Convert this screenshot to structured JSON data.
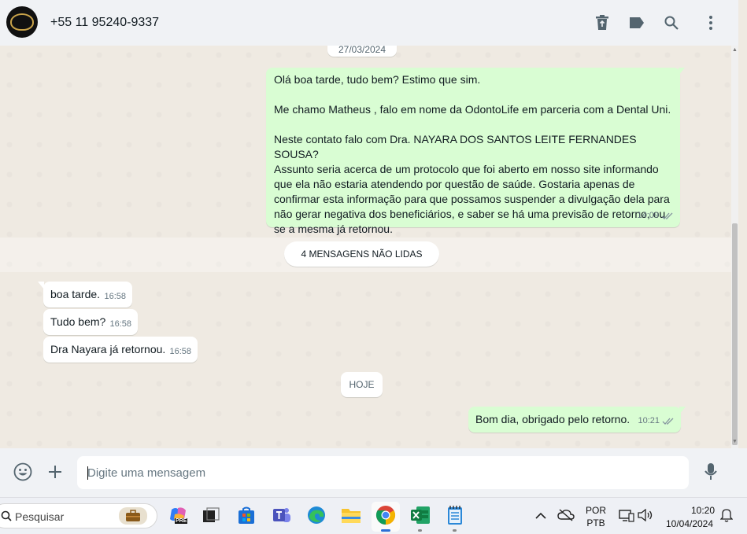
{
  "header": {
    "contact_name": "+55 11 95240-9337",
    "icons": [
      "delete-icon",
      "label-icon",
      "search-icon",
      "menu-icon"
    ]
  },
  "chat": {
    "date_top": "27/03/2024",
    "outgoing_long": {
      "lines": [
        "Olá boa tarde, tudo bem? Estimo que sim.",
        "",
        "Me chamo Matheus , falo em nome da OdontoLife em parceria com a Dental Uni.",
        "",
        "Neste contato falo com Dra. NAYARA DOS SANTOS LEITE FERNANDES SOUSA?",
        "Assunto seria acerca de um protocolo que foi aberto em nosso site informando",
        "que ela não estaria atendendo por questão de saúde. Gostaria apenas de",
        "confirmar esta informação para que possamos suspender a divulgação dela para",
        "não gerar negativa dos beneficiários, e saber se há uma previsão de retorno, ou",
        "se a mesma já retornou."
      ],
      "time": "14:09"
    },
    "unread_label": "4 MENSAGENS NÃO LIDAS",
    "incoming": [
      {
        "text": "boa tarde.",
        "time": "16:58"
      },
      {
        "text": "Tudo bem?",
        "time": "16:58"
      },
      {
        "text": "Dra Nayara já retornou.",
        "time": "16:58"
      }
    ],
    "date_today": "HOJE",
    "outgoing_last": {
      "text": "Bom dia, obrigado pelo retorno.",
      "time": "10:21"
    }
  },
  "composer": {
    "placeholder": "Digite uma mensagem",
    "icons": [
      "emoji-icon",
      "attach-plus-icon",
      "microphone-icon"
    ]
  },
  "taskbar": {
    "search_label": "Pesquisar",
    "language_top": "POR",
    "language_bottom": "PTB",
    "time": "10:20",
    "date": "10/04/2024",
    "copilot_badge": "PRE"
  },
  "colors": {
    "outgoing_bubble": "#d9fdd3",
    "incoming_bubble": "#ffffff",
    "chat_background": "#efeae2",
    "header_background": "#f0f2f5"
  }
}
